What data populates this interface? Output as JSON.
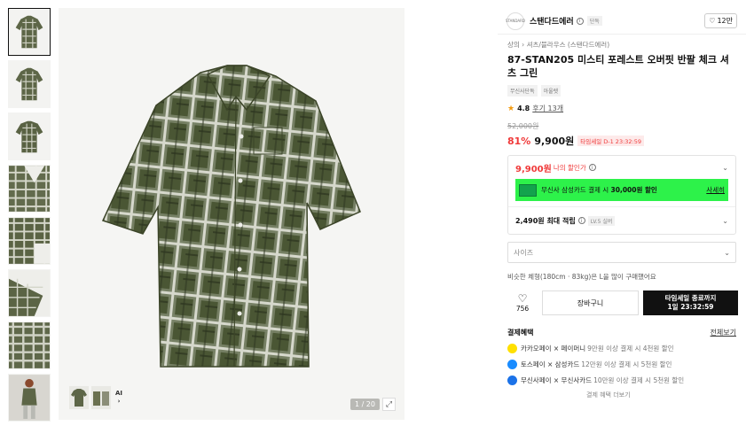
{
  "thumbnails": [
    {
      "name": "thumb-front"
    },
    {
      "name": "thumb-front-2"
    },
    {
      "name": "thumb-back"
    },
    {
      "name": "thumb-detail-collar"
    },
    {
      "name": "thumb-detail-sleeve"
    },
    {
      "name": "thumb-detail-hem"
    },
    {
      "name": "thumb-detail-fabric"
    },
    {
      "name": "thumb-model"
    }
  ],
  "gallery": {
    "counter": "1 / 20",
    "ai_label": "AI",
    "ai_arrow": "›",
    "zoom_icon": "expand-icon"
  },
  "brand": {
    "logo_text": "STANDARD",
    "name": "스탠다드에러",
    "exclusive_tag": "단독",
    "like_count": "12만"
  },
  "breadcrumb": "상의 › 셔츠/블라우스 (스탠다드에러)",
  "product": {
    "title": "87-STAN205 미스티 포레스트 오버핏 반팔 체크 셔츠 그린",
    "tags": [
      "무신사단독",
      "아울렛"
    ],
    "rating": "4.8",
    "review_label": "후기 13개",
    "original_price": "52,000원",
    "discount": "81%",
    "price": "9,900원",
    "timesale_label": "타임세일 D-1 23:32:59"
  },
  "my_price": {
    "price": "9,900원",
    "label": "나의 할인가"
  },
  "promo": {
    "text_prefix": "무신사 삼성카드 결제 시",
    "text_bold": "30,000원 할인",
    "link": "사세히"
  },
  "points": {
    "label": "2,490원 최대 적립",
    "level": "LV.5 실버"
  },
  "size_select": {
    "placeholder": "사이즈"
  },
  "fit_note": "비슷한 체형(180cm · 83kg)은 L을 많이 구매했어요",
  "actions": {
    "like_count": "756",
    "cart_label": "장바구니",
    "buy_line1": "타임세일 종료까지",
    "buy_line2": "1일 23:32:59"
  },
  "payment": {
    "title": "결제혜택",
    "more_link": "전체보기",
    "items": [
      {
        "label": "카카오페이 × 페이머니",
        "detail": "9만원 이상 결제 시 4천원 할인",
        "color": "#ffe000"
      },
      {
        "label": "토스페이 × 삼성카드",
        "detail": "12만원 이상 결제 시 5천원 할인",
        "color": "#1a8cff"
      },
      {
        "label": "무신사페이 × 무신사카드",
        "detail": "10만원 이상 결제 시 5천원 할인",
        "color": "#1b72e8"
      }
    ],
    "more_text": "결제 혜택 더보기"
  },
  "colors": {
    "accent_red": "#f03a3a",
    "promo_green": "#2df24a",
    "shirt_dark": "#4a5634",
    "shirt_light": "#d6d8cc"
  }
}
